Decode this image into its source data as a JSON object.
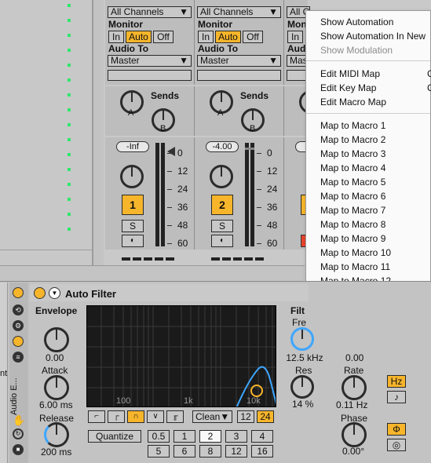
{
  "tracks": [
    {
      "input_channel": "All Channels",
      "monitor_label": "Monitor",
      "monitor": [
        "In",
        "Auto",
        "Off"
      ],
      "audio_to_label": "Audio To",
      "audio_to": "Master",
      "sends_label": "Sends",
      "send_a": "A",
      "send_b": "B",
      "volume": "-Inf",
      "track_number": "1",
      "solo": "S",
      "meter_ticks": [
        "0",
        "12",
        "24",
        "36",
        "48",
        "60"
      ]
    },
    {
      "input_channel": "All Channels",
      "monitor_label": "Monitor",
      "monitor": [
        "In",
        "Auto",
        "Off"
      ],
      "audio_to_label": "Audio To",
      "audio_to": "Master",
      "sends_label": "Sends",
      "send_a": "A",
      "send_b": "B",
      "volume": "-4.00",
      "track_number": "2",
      "solo": "S",
      "meter_ticks": [
        "0",
        "12",
        "24",
        "36",
        "48",
        "60"
      ]
    },
    {
      "input_channel": "All Channels",
      "monitor_label": "Mon",
      "monitor": [
        "In"
      ],
      "audio_to_label": "Aud",
      "audio_to": "Mas"
    }
  ],
  "context_menu": {
    "items": [
      {
        "label": "Show Automation",
        "enabled": true
      },
      {
        "label": "Show Automation In New",
        "enabled": true
      },
      {
        "label": "Show Modulation",
        "enabled": false
      },
      {
        "label": "Edit MIDI Map",
        "enabled": true,
        "shortcut": "C"
      },
      {
        "label": "Edit Key Map",
        "enabled": true,
        "shortcut": "C"
      },
      {
        "label": "Edit Macro Map",
        "enabled": true
      }
    ],
    "macros": [
      "Map to Macro 1",
      "Map to Macro 2",
      "Map to Macro 3",
      "Map to Macro 4",
      "Map to Macro 5",
      "Map to Macro 6",
      "Map to Macro 7",
      "Map to Macro 8",
      "Map to Macro 9",
      "Map to Macro 10",
      "Map to Macro 11",
      "Map to Macro 12",
      "Map to Macro 13",
      "Map to Macro 14",
      "Map to Macro 15",
      "Map to Macro 16"
    ]
  },
  "device": {
    "title": "Auto Filter",
    "side_label": "Audio E...",
    "left_edge_label": "nt",
    "envelope_label": "Envelope",
    "envelope_value": "0.00",
    "attack_label": "Attack",
    "attack_value": "6.00 ms",
    "release_label": "Release",
    "release_value": "200 ms",
    "filter_label": "Filt",
    "freq_label": "Fre",
    "freq_value": "12.5 kHz",
    "res_label": "Res",
    "res_value": "14 %",
    "lfo_value": "0.00",
    "rate_label": "Rate",
    "rate_value": "0.11 Hz",
    "phase_label": "Phase",
    "phase_value": "0.00°",
    "hz_label": "Hz",
    "note_icon": "♪",
    "phi_icon": "Φ",
    "graph_ticks": [
      "100",
      "1k",
      "10k"
    ],
    "circuit": "Clean",
    "slope_12": "12",
    "slope_24": "24",
    "quantize_label": "Quantize",
    "quantize_row1": [
      "0.5",
      "1",
      "2",
      "3",
      "4"
    ],
    "quantize_row2": [
      "5",
      "6",
      "8",
      "12",
      "16"
    ],
    "accent": "#f7b52b"
  }
}
